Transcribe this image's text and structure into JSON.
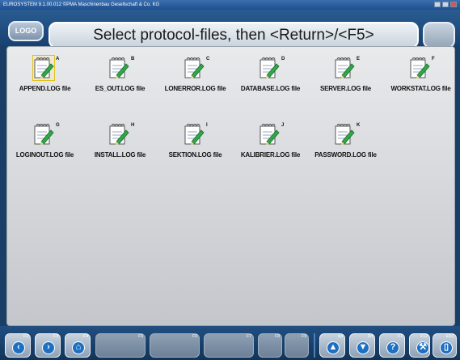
{
  "window": {
    "title": "EUROSYSTEM 9.1.00.012 ©PMA Maschinenbau Gesellschaft & Co. KG"
  },
  "header": {
    "logo_label": "LOGO",
    "title": "Select protocol-files, then <Return>/<F5>"
  },
  "files": [
    {
      "letter": "A",
      "label": "APPEND.LOG file",
      "selected": true
    },
    {
      "letter": "B",
      "label": "ES_OUT.LOG file",
      "selected": false
    },
    {
      "letter": "C",
      "label": "LONERROR.LOG file",
      "selected": false
    },
    {
      "letter": "D",
      "label": "DATABASE.LOG file",
      "selected": false
    },
    {
      "letter": "E",
      "label": "SERVER.LOG file",
      "selected": false
    },
    {
      "letter": "F",
      "label": "WORKSTAT.LOG file",
      "selected": false
    },
    {
      "letter": "G",
      "label": "LOGINOUT.LOG file",
      "selected": false
    },
    {
      "letter": "H",
      "label": "INSTALL.LOG file",
      "selected": false
    },
    {
      "letter": "I",
      "label": "SEKTION.LOG file",
      "selected": false
    },
    {
      "letter": "J",
      "label": "KALIBRIER.LOG file",
      "selected": false
    },
    {
      "letter": "K",
      "label": "PASSWORD.LOG file",
      "selected": false
    }
  ],
  "footer": {
    "keys": [
      {
        "key": "F2",
        "icon": "back-arrow-icon"
      },
      {
        "key": "F3",
        "icon": "forward-arrow-icon"
      },
      {
        "key": "F4",
        "icon": "home-icon"
      },
      {
        "key": "F5",
        "icon": ""
      },
      {
        "key": "F6",
        "icon": ""
      },
      {
        "key": "F7",
        "icon": ""
      },
      {
        "key": "F8",
        "icon": ""
      },
      {
        "key": "F9",
        "icon": ""
      },
      {
        "key": "Up",
        "icon": "up-icon"
      },
      {
        "key": "Dn",
        "icon": "down-icon"
      },
      {
        "key": "F1",
        "icon": "help-icon"
      },
      {
        "key": "F12",
        "icon": "tools-icon"
      },
      {
        "key": "ESC",
        "icon": "exit-icon"
      }
    ]
  },
  "colors": {
    "accent": "#1d6fc2",
    "selection": "#e2c21a"
  }
}
